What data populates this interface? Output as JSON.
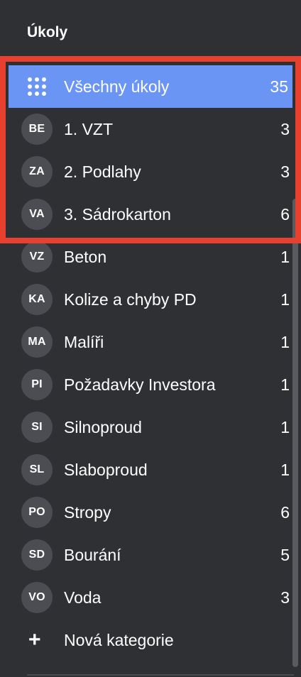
{
  "header": {
    "title": "Úkoly"
  },
  "categories": [
    {
      "avatar": "",
      "label": "Všechny úkoly",
      "count": "35",
      "active": true
    },
    {
      "avatar": "BE",
      "label": "1. VZT",
      "count": "3"
    },
    {
      "avatar": "ZA",
      "label": "2. Podlahy",
      "count": "3"
    },
    {
      "avatar": "VA",
      "label": "3. Sádrokarton",
      "count": "6"
    },
    {
      "avatar": "VZ",
      "label": "Beton",
      "count": "1"
    },
    {
      "avatar": "KA",
      "label": "Kolize a chyby PD",
      "count": "1"
    },
    {
      "avatar": "MA",
      "label": "Malíři",
      "count": "1"
    },
    {
      "avatar": "PI",
      "label": "Požadavky Investora",
      "count": "1"
    },
    {
      "avatar": "SI",
      "label": "Silnoproud",
      "count": "1"
    },
    {
      "avatar": "SL",
      "label": "Slaboproud",
      "count": "1"
    },
    {
      "avatar": "PO",
      "label": "Stropy",
      "count": "6"
    },
    {
      "avatar": "SD",
      "label": "Bourání",
      "count": "5"
    },
    {
      "avatar": "VO",
      "label": "Voda",
      "count": "3"
    }
  ],
  "new_category": {
    "label": "Nová kategorie",
    "icon": "plus-icon"
  },
  "colors": {
    "background": "#2f3033",
    "active": "#6a95f4",
    "avatar": "#4c4d52",
    "highlight": "#e8402f"
  }
}
